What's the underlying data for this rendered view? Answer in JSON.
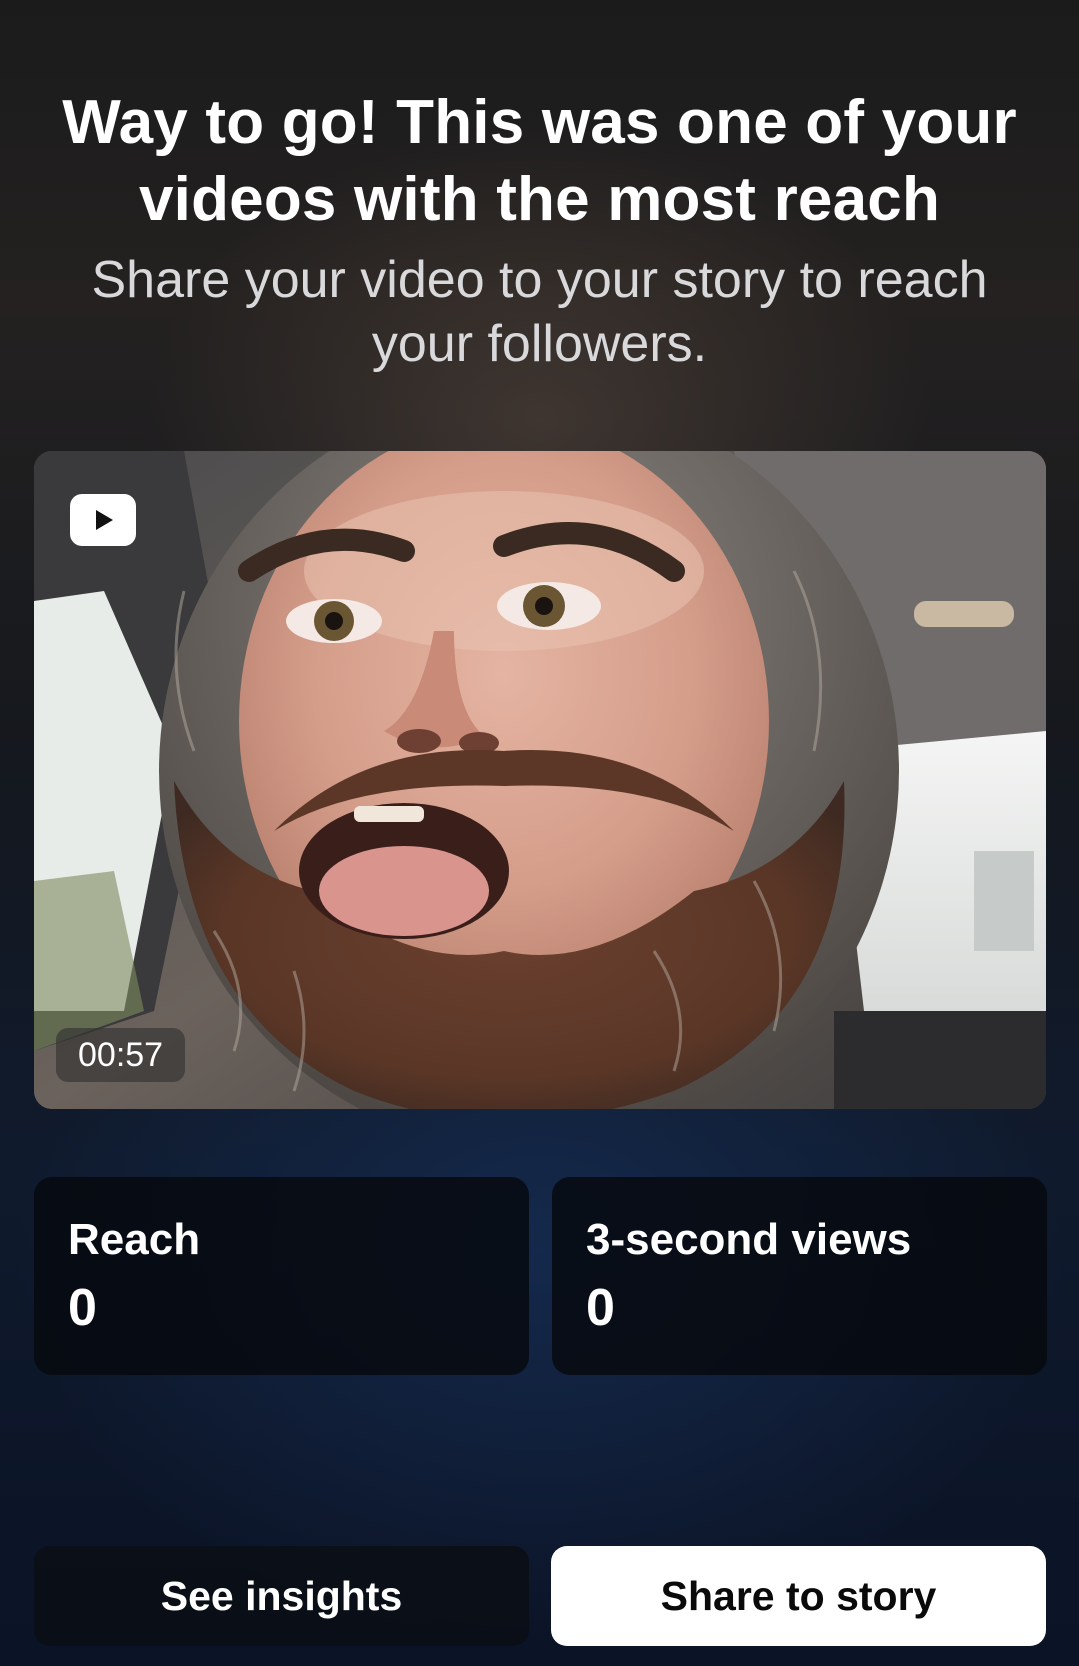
{
  "header": {
    "title": "Way to go! This was one of your videos with the most reach",
    "subtitle": "Share your video to your story to reach your followers."
  },
  "video": {
    "type_icon": "video-play-icon",
    "duration": "00:57"
  },
  "stats": [
    {
      "label": "Reach",
      "value": "0"
    },
    {
      "label": "3-second views",
      "value": "0"
    }
  ],
  "actions": {
    "see_insights_label": "See insights",
    "share_story_label": "Share to story"
  },
  "colors": {
    "primary_button_bg": "#ffffff",
    "primary_button_text": "#0a0a0a",
    "secondary_button_bg": "#0a0e16",
    "card_bg": "#06080e"
  }
}
